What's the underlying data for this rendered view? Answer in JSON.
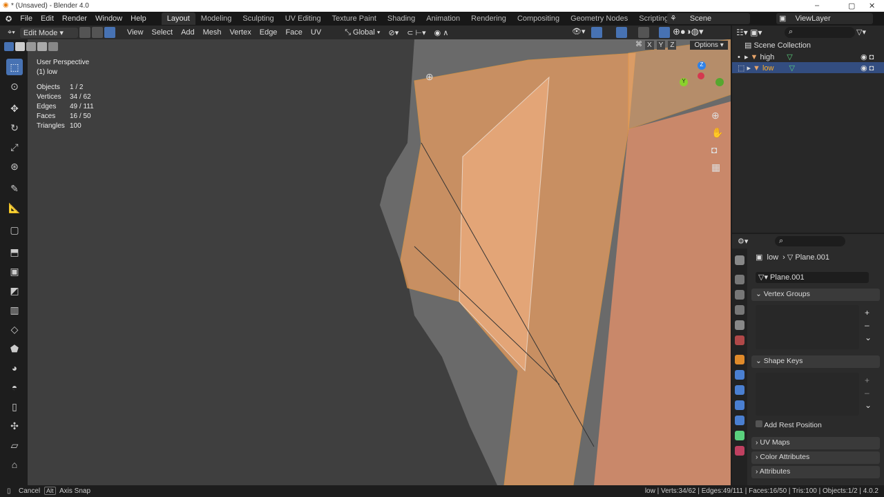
{
  "window": {
    "title": "* (Unsaved) - Blender 4.0",
    "minimize": "–",
    "maximize": "▢",
    "close": "✕"
  },
  "menu": [
    "File",
    "Edit",
    "Render",
    "Window",
    "Help"
  ],
  "workspaces": [
    "Layout",
    "Modeling",
    "Sculpting",
    "UV Editing",
    "Texture Paint",
    "Shading",
    "Animation",
    "Rendering",
    "Compositing",
    "Geometry Nodes",
    "Scripting",
    "+"
  ],
  "scene": "Scene",
  "view_layer": "ViewLayer",
  "header": {
    "mode": "Edit Mode",
    "menus": [
      "View",
      "Select",
      "Add",
      "Mesh",
      "Vertex",
      "Edge",
      "Face",
      "UV"
    ],
    "orientation": "Global",
    "options": "Options",
    "axes": [
      "X",
      "Y",
      "Z"
    ]
  },
  "overlay": {
    "view": "User Perspective",
    "object": "(1) low",
    "stats": [
      [
        "Objects",
        "1 / 2"
      ],
      [
        "Vertices",
        "34 / 62"
      ],
      [
        "Edges",
        "49 / 111"
      ],
      [
        "Faces",
        "16 / 50"
      ],
      [
        "Triangles",
        "100"
      ]
    ]
  },
  "gizmo": {
    "x": "X",
    "y": "Y",
    "z": "Z"
  },
  "outliner": {
    "root": "Scene Collection",
    "items": [
      {
        "name": "high",
        "selected": false
      },
      {
        "name": "low",
        "selected": true
      }
    ]
  },
  "properties": {
    "object": "low",
    "mesh": "Plane.001",
    "data_name": "Plane.001",
    "sections": {
      "vertex_groups": "Vertex Groups",
      "shape_keys": "Shape Keys",
      "add_rest": "Add Rest Position",
      "uv_maps": "UV Maps",
      "color_attributes": "Color Attributes",
      "attributes": "Attributes"
    }
  },
  "status": {
    "cancel": "Cancel",
    "alt": "Alt",
    "axis_snap": "Axis Snap",
    "right": "low | Verts:34/62 | Edges:49/111 | Faces:16/50 | Tris:100 | Objects:1/2 | 4.0.2"
  },
  "colors": {
    "accent": "#4772b3",
    "mesh": "#e8a56a",
    "edge": "#f5a142"
  }
}
